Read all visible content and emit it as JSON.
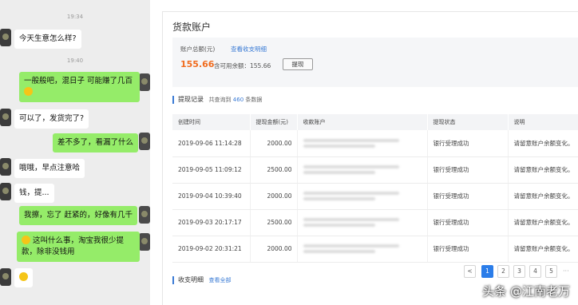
{
  "chat": {
    "timestamps": [
      "19:34",
      "19:40"
    ],
    "messages": [
      {
        "side": "left",
        "text": "今天生意怎么样?"
      },
      {
        "side": "right",
        "text": "一般般吧，混日子 可能赚了几百"
      },
      {
        "side": "left",
        "text": "可以了，发货完了?"
      },
      {
        "side": "right",
        "text": "差不多了，看漏了什么"
      },
      {
        "side": "left",
        "text": "哦哦，早点注意哈"
      },
      {
        "side": "left",
        "text": "钱，提..."
      },
      {
        "side": "right",
        "text": "我擦，忘了 赶紧的，好像有几千"
      },
      {
        "side": "right",
        "text": "这叫什么事，淘宝我很少提款，除非没钱用"
      }
    ]
  },
  "account": {
    "title": "货款账户",
    "total_label": "账户总额(元)",
    "details_link": "查看收支明细",
    "amount": "155.66",
    "available_text": "含可用余额：155.66",
    "withdraw_button": "提现"
  },
  "records": {
    "heading": "提现记录",
    "count_prefix": "共查询到",
    "count": "460",
    "count_suffix": "条数据",
    "columns": [
      "创建时间",
      "提现金额(元)",
      "收款账户",
      "提现状态",
      "说明"
    ],
    "rows": [
      {
        "time": "2019-09-06 11:14:28",
        "amount": "2000.00",
        "status": "银行受理成功",
        "note": "请留意账户余额变化。"
      },
      {
        "time": "2019-09-05 11:09:12",
        "amount": "2500.00",
        "status": "银行受理成功",
        "note": "请留意账户余额变化。"
      },
      {
        "time": "2019-09-04 10:39:40",
        "amount": "2000.00",
        "status": "银行受理成功",
        "note": "请留意账户余额变化。"
      },
      {
        "time": "2019-09-03 20:17:17",
        "amount": "2500.00",
        "status": "银行受理成功",
        "note": "请留意账户余额变化。"
      },
      {
        "time": "2019-09-02 20:31:21",
        "amount": "2000.00",
        "status": "银行受理成功",
        "note": "请留意账户余额变化。"
      }
    ]
  },
  "pager": {
    "prev": "<",
    "pages": [
      "1",
      "2",
      "3",
      "4",
      "5"
    ],
    "current": "1",
    "ellipsis": "···"
  },
  "ledger": {
    "heading": "收支明细",
    "link": "查看全部"
  },
  "watermark": "头条 @江南老万"
}
